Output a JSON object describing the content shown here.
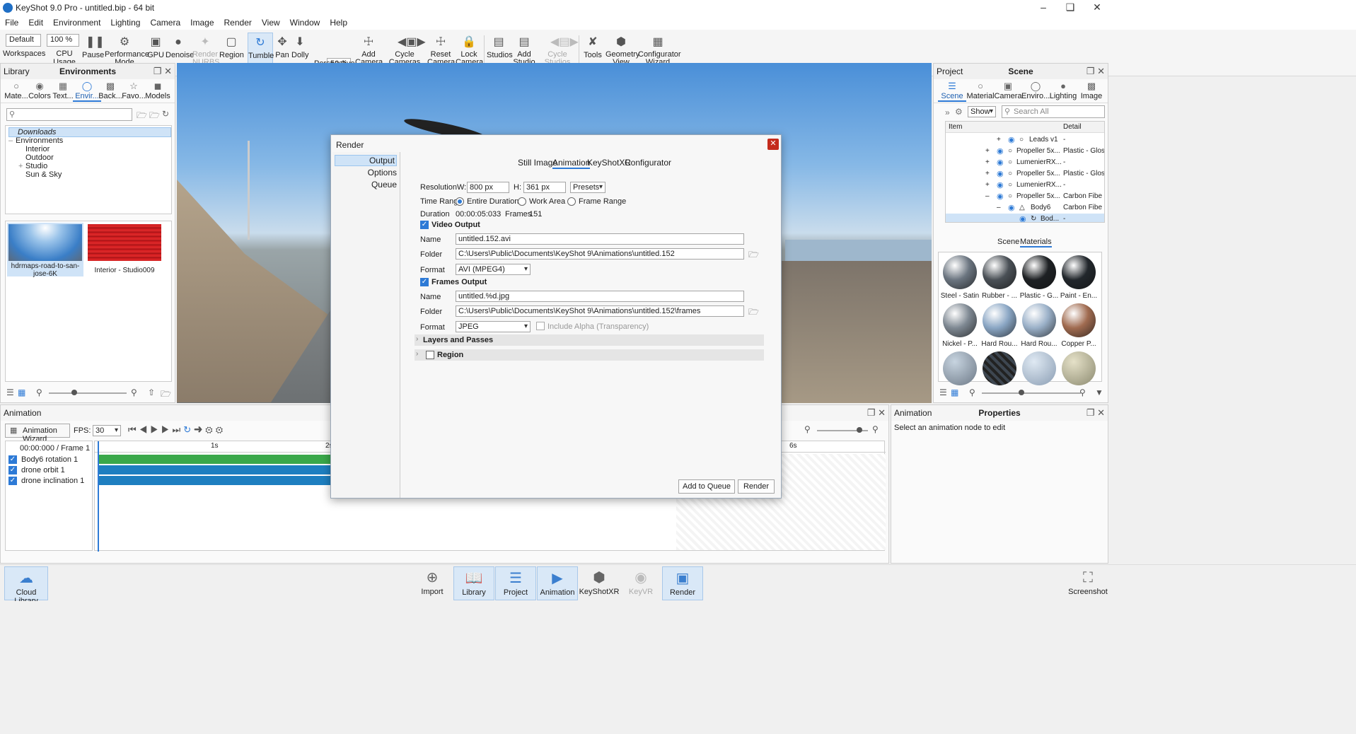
{
  "window": {
    "title": "KeyShot 9.0 Pro - untitled.bip - 64 bit",
    "controls": [
      "–",
      "❑",
      "✕"
    ]
  },
  "menu": [
    "File",
    "Edit",
    "Environment",
    "Lighting",
    "Camera",
    "Image",
    "Render",
    "View",
    "Window",
    "Help"
  ],
  "toolbar": {
    "workspace_value": "Default",
    "cpu_value": "100 %",
    "fov_value": "50.0",
    "buttons": {
      "workspaces": "Workspaces",
      "cpu_usage": "CPU Usage",
      "pause": "Pause",
      "performance_mode": "Performance\nMode",
      "gpu": "GPU",
      "denoise": "Denoise",
      "render_nurbs": "Render\nNURBS",
      "region": "Region",
      "tumble": "Tumble",
      "pan": "Pan",
      "dolly": "Dolly",
      "perspective": "Perspective",
      "add_camera": "Add\nCamera",
      "cycle_cameras": "Cycle\nCameras",
      "reset_camera": "Reset\nCamera",
      "lock_camera": "Lock\nCamera",
      "studios": "Studios",
      "add_studio": "Add\nStudio",
      "cycle_studios": "Cycle\nStudios",
      "tools": "Tools",
      "geometry_view": "Geometry\nView",
      "configurator_wizard": "Configurator\nWizard"
    }
  },
  "library": {
    "header_left": "Library",
    "header_title": "Environments",
    "tabs": [
      "Mate...",
      "Colors",
      "Text...",
      "Envir...",
      "Back...",
      "Favo...",
      "Models"
    ],
    "tree": [
      "Downloads",
      "Environments",
      "Interior",
      "Outdoor",
      "Studio",
      "Sun & Sky"
    ],
    "thumbs": [
      {
        "label": "hdrmaps-road-to-san-\njose-6K"
      },
      {
        "label": "Interior - Studio009"
      }
    ]
  },
  "project": {
    "header_left": "Project",
    "header_title": "Scene",
    "tabs": [
      "Scene",
      "Material",
      "Camera",
      "Enviro...",
      "Lighting",
      "Image"
    ],
    "show_value": "Show",
    "search_placeholder": "Search All",
    "columns": [
      "Item",
      "Detail"
    ],
    "rows": [
      {
        "name": "Leads v1",
        "detail": "-"
      },
      {
        "name": "Propeller 5x...",
        "detail": "Plastic - Glos"
      },
      {
        "name": "LumenierRX...",
        "detail": "-"
      },
      {
        "name": "Propeller 5x...",
        "detail": "Plastic - Glos"
      },
      {
        "name": "LumenierRX...",
        "detail": "-"
      },
      {
        "name": "Propeller 5x...",
        "detail": "Carbon Fibe"
      },
      {
        "name": "Body6",
        "detail": "Carbon Fibe"
      },
      {
        "name": "Bod...",
        "detail": "-"
      }
    ],
    "subtabs": [
      "Scene",
      "Materials"
    ],
    "materials": [
      {
        "label": "Steel - Satin",
        "color": "#6b7580"
      },
      {
        "label": "Rubber - ...",
        "color": "#4a5056"
      },
      {
        "label": "Plastic - G...",
        "color": "#1e2124"
      },
      {
        "label": "Paint - En...",
        "color": "#22272c"
      },
      {
        "label": "Nickel - P...",
        "color": "#7e8892"
      },
      {
        "label": "Hard Rou...",
        "color": "#8aa6c4"
      },
      {
        "label": "Hard Rou...",
        "color": "#9ab0c8"
      },
      {
        "label": "Copper P...",
        "color": "#a06b50"
      }
    ]
  },
  "dialog": {
    "title": "Render",
    "close": "✕",
    "nav": [
      "Output",
      "Options",
      "Queue"
    ],
    "tabs": [
      "Still Image",
      "Animation",
      "KeyShotXR",
      "Configurator"
    ],
    "resolution_label": "Resolution",
    "w_label": "W:",
    "w_value": "800 px",
    "h_label": "H:",
    "h_value": "361 px",
    "presets": "Presets",
    "time_range_label": "Time Range",
    "time_range_options": [
      "Entire Duration",
      "Work Area",
      "Frame Range"
    ],
    "duration_label": "Duration",
    "duration_value": "00:00:05:033",
    "frames_label": "Frames",
    "frames_value": "151",
    "video_output_label": "Video Output",
    "video_name_label": "Name",
    "video_name": "untitled.152.avi",
    "video_folder_label": "Folder",
    "video_folder": "C:\\Users\\Public\\Documents\\KeyShot 9\\Animations\\untitled.152",
    "video_format_label": "Format",
    "video_format": "AVI (MPEG4)",
    "frames_output_label": "Frames Output",
    "frames_name_label": "Name",
    "frames_name": "untitled.%d.jpg",
    "frames_folder_label": "Folder",
    "frames_folder": "C:\\Users\\Public\\Documents\\KeyShot 9\\Animations\\untitled.152\\frames",
    "frames_format_label": "Format",
    "frames_format": "JPEG",
    "include_alpha": "Include Alpha (Transparency)",
    "layers_and_passes": "Layers and Passes",
    "region": "Region",
    "add_to_queue": "Add to Queue",
    "render": "Render"
  },
  "animation": {
    "header": "Animation",
    "wizard": "Animation Wizard",
    "fps_label": "FPS:",
    "fps_value": "30",
    "timecode": "00:00:000 / Frame 1",
    "ruler": [
      "1s",
      "2s",
      "6s"
    ],
    "tracks": [
      {
        "name": "Body6 rotation 1",
        "color": "#3aa84a"
      },
      {
        "name": "drone orbit 1",
        "color": "#1e7fc0"
      },
      {
        "name": "drone inclination 1",
        "color": "#1e7fc0"
      }
    ]
  },
  "properties": {
    "header_left": "Animation",
    "header_title": "Properties",
    "hint": "Select an animation node to edit"
  },
  "dock": {
    "cloud_library": "Cloud Library",
    "import": "Import",
    "library": "Library",
    "project": "Project",
    "animation": "Animation",
    "keyshotxr": "KeyShotXR",
    "keyvr": "KeyVR",
    "render": "Render",
    "screenshot": "Screenshot"
  }
}
